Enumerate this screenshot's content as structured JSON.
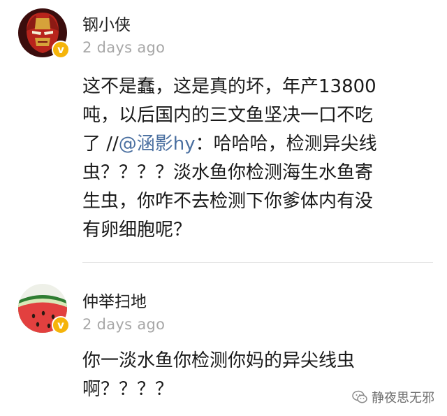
{
  "comments": [
    {
      "username": "钢小侠",
      "timestamp": "2 days ago",
      "verified": true,
      "avatar_icon": "iron-man-mask-avatar",
      "lines": [
        {
          "text": "这不是蠢，这是真的坏，年产13800"
        },
        {
          "text": "吨，以后国内的三文鱼坚决一口不吃"
        },
        {
          "prefix": "了 //",
          "mention": "@涵影hy",
          "suffix": "：哈哈哈，检测异尖线"
        },
        {
          "text": "虫？？？？淡水鱼你检测海生水鱼寄"
        },
        {
          "text": "生虫，你咋不去检测下你爹体内有没"
        },
        {
          "text": "有卵细胞呢？"
        }
      ]
    },
    {
      "username": "仲举扫地",
      "timestamp": "2 days ago",
      "verified": true,
      "avatar_icon": "watermelon-slice-avatar",
      "lines": [
        {
          "text": "你一淡水鱼你检测你妈的异尖线虫"
        },
        {
          "text": "啊？？？？"
        }
      ]
    }
  ],
  "verified_badge_glyph": "v",
  "watermark": {
    "text": "静夜思无邪",
    "icon": "wechat-official-account-icon"
  },
  "colors": {
    "mention": "#4a6fa0",
    "timestamp": "#a7a7a7",
    "badge": "#f5b40a"
  }
}
